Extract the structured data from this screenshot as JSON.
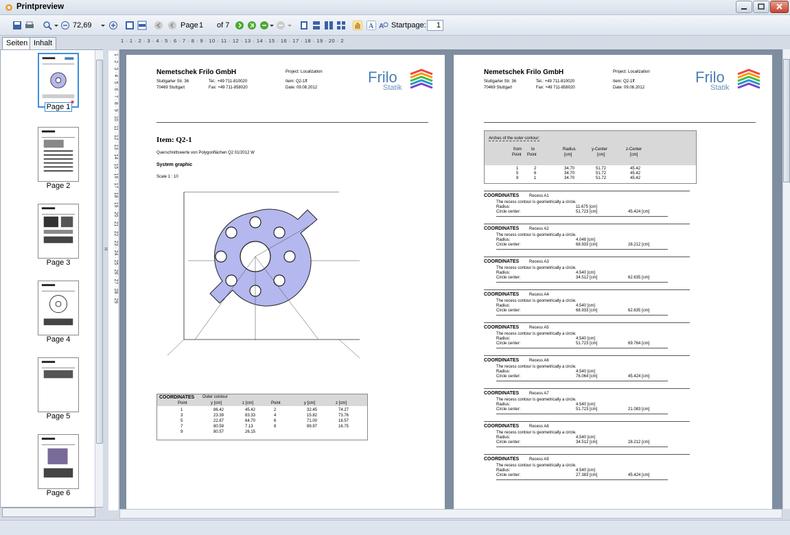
{
  "window": {
    "title": "Printpreview",
    "icon": "printpreview-app-icon"
  },
  "toolbar": {
    "zoom": "72,69",
    "page_label": "Page",
    "page_value": "1",
    "of_label": "of 7",
    "startpage_label": "Startpage:",
    "startpage_value": "1"
  },
  "tabs": [
    "Seiten",
    "Inhalt"
  ],
  "ruler": {
    "horizontal": "1 · 1 · 2 · 3 · 4 · 5 · 6 · 7 · 8 · 9 · 10 · 11 · 12 · 13 · 14 · 15 · 16 · 17 · 18 · 19 · 20 · 2",
    "vertical": "1 · 2 · 3 · 4 · 5 · 6 · 7 · 8 · 9 · 10 · 11 · 12 · 13 · 14 · 15 · 16 · 17 · 18 · 19 · 20 · 21 · 22 · 23 · 24 · 25 · 26 · 27 · 28 · 29"
  },
  "thumbnails": [
    "Page 1",
    "Page 2",
    "Page 3",
    "Page 4",
    "Page 5",
    "Page 6"
  ],
  "header": {
    "company": "Nemetschek Frilo GmbH",
    "street": "Stuttgarter Str. 36",
    "city": "70469   Stuttgart",
    "tel": "Tel.:   +49 711-810020",
    "fax": "Fax:   +49 711-858020",
    "project": "Project: Localization",
    "item": "Item: Q2-1ff",
    "date": "Date: 09.08.2012",
    "logo_main": "Frilo",
    "logo_sub": "Statik"
  },
  "page1": {
    "item_title": "Item: Q2-1",
    "subtitle": "Querschnittswerte von Polygonflächen   Q2  01/2012   W",
    "system_graphic": "System graphic",
    "scale": "Scale 1 : 10",
    "coord_title": "COORDINATES",
    "coord_sub": "Outer contour",
    "coord_headers": [
      "Point",
      "y [cm]",
      "z [cm]",
      "Point",
      "y [cm]",
      "z [cm]"
    ],
    "coord_rows": [
      [
        "1",
        "86.42",
        "45.42",
        "2",
        "32.45",
        "74.27"
      ],
      [
        "3",
        "23.39",
        "83.33",
        "4",
        "15.82",
        "73.76"
      ],
      [
        "5",
        "22.87",
        "64.70",
        "6",
        "71.00",
        "16.57"
      ],
      [
        "7",
        "80.59",
        "7.13",
        "8",
        "89.97",
        "16.75"
      ],
      [
        "9",
        "80.57",
        "26.15",
        "",
        "",
        ""
      ]
    ]
  },
  "page2": {
    "arches_title": "Arches of the outer contour:",
    "arches_headers": [
      "from",
      "to",
      "Radius",
      "y-Center",
      "z-Center"
    ],
    "arches_headers2": [
      "Point",
      "Point",
      "[cm]",
      "[cm]",
      "[cm]"
    ],
    "arches_rows": [
      [
        "1",
        "2",
        "34.70",
        "51.72",
        "45.42"
      ],
      [
        "5",
        "6",
        "34.70",
        "51.72",
        "45.42"
      ],
      [
        "9",
        "1",
        "34.70",
        "51.72",
        "45.42"
      ]
    ],
    "recess_intro": "The recess contour is geometrically a circle.",
    "radius_label": "Radius:",
    "center_label": "Circle center:",
    "recesses": [
      {
        "title": "COORDINATES",
        "name": "Recess A1",
        "r": "11.675 [cm]",
        "y": "51.723 [cm]",
        "z": "45.424 [cm]"
      },
      {
        "title": "COORDINATES",
        "name": "Recess A2",
        "r": "4.048 [cm]",
        "y": "68.933 [cm]",
        "z": "28.212 [cm]"
      },
      {
        "title": "COORDINATES",
        "name": "Recess A3",
        "r": "4.540 [cm]",
        "y": "34.512 [cm]",
        "z": "62.635 [cm]"
      },
      {
        "title": "COORDINATES",
        "name": "Recess A4",
        "r": "4.540 [cm]",
        "y": "68.933 [cm]",
        "z": "62.635 [cm]"
      },
      {
        "title": "COORDINATES",
        "name": "Recess A5",
        "r": "4.540 [cm]",
        "y": "51.723 [cm]",
        "z": "69.764 [cm]"
      },
      {
        "title": "COORDINATES",
        "name": "Recess A6",
        "r": "4.540 [cm]",
        "y": "76.064 [cm]",
        "z": "45.424 [cm]"
      },
      {
        "title": "COORDINATES",
        "name": "Recess A7",
        "r": "4.540 [cm]",
        "y": "51.723 [cm]",
        "z": "21.083 [cm]"
      },
      {
        "title": "COORDINATES",
        "name": "Recess A8",
        "r": "4.540 [cm]",
        "y": "34.512 [cm]",
        "z": "28.212 [cm]"
      },
      {
        "title": "COORDINATES",
        "name": "Recess A9",
        "r": "4.540 [cm]",
        "y": "27.383 [cm]",
        "z": "45.424 [cm]"
      }
    ]
  },
  "colors": {
    "section_fill": "#b4b8ee",
    "accent": "#3b8fd8",
    "chrome": "#d4dbe5"
  }
}
